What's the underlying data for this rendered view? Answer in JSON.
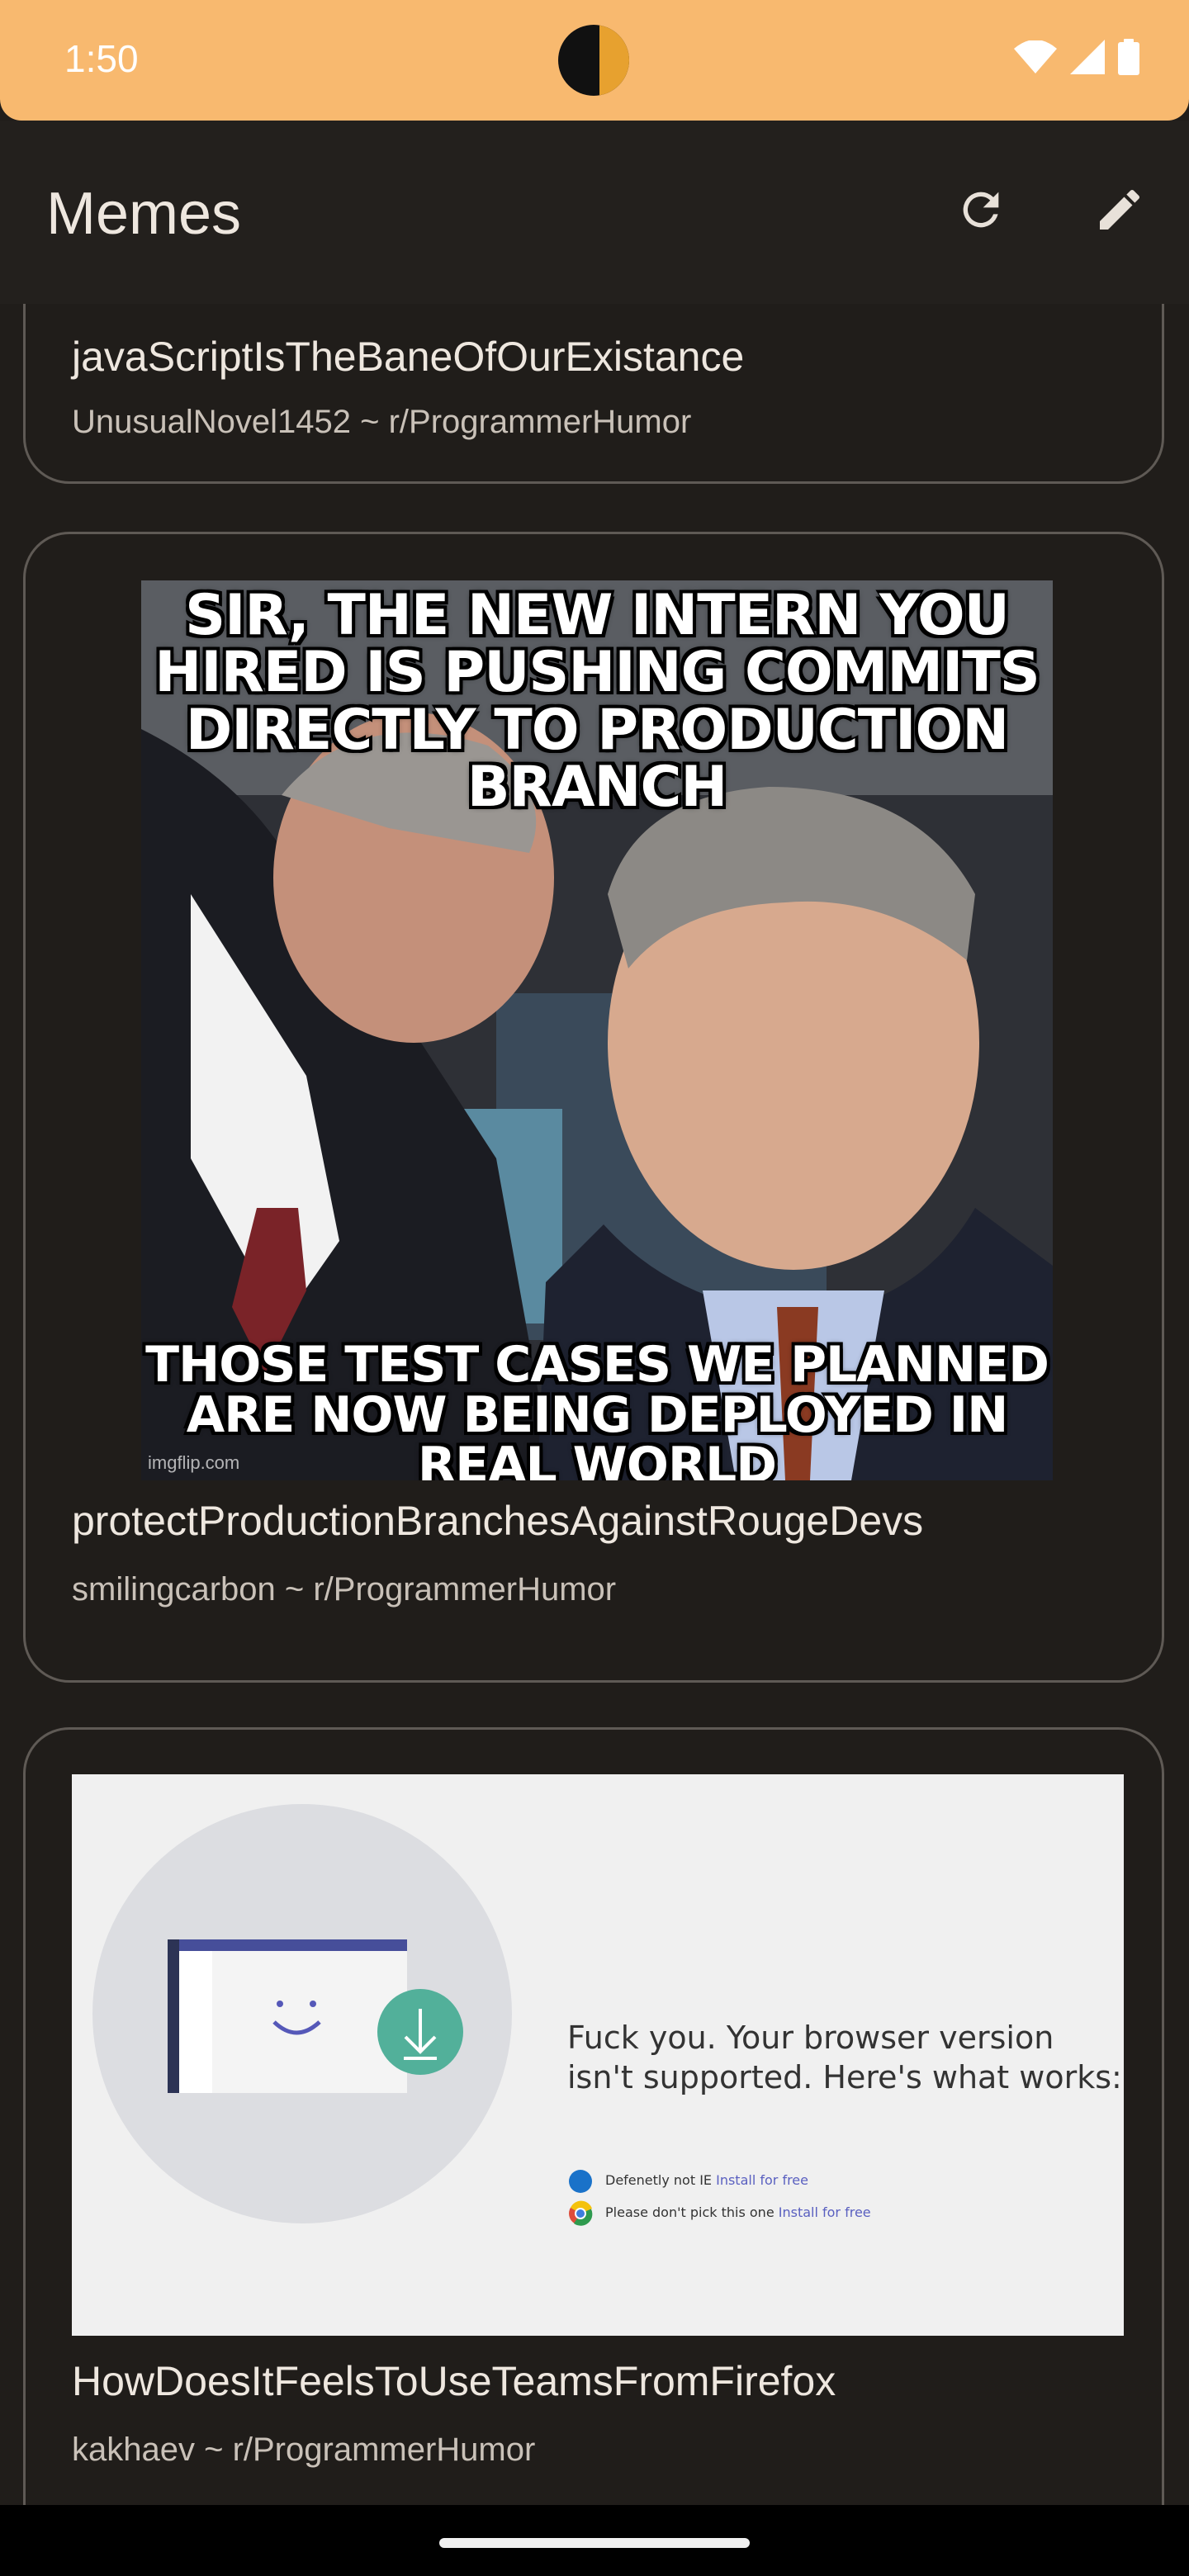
{
  "status_bar": {
    "time": "1:50",
    "icons": [
      "wifi-icon",
      "cell-signal-icon",
      "battery-icon"
    ]
  },
  "app_bar": {
    "title": "Memes",
    "actions": [
      "refresh-icon",
      "edit-icon"
    ]
  },
  "posts": [
    {
      "title": "javaScriptIsTheBaneOfOurExistance",
      "subtitle": "UnusualNovel1452 ~ r/ProgrammerHumor"
    },
    {
      "title": "protectProductionBranchesAgainstRougeDevs",
      "subtitle": "smilingcarbon ~ r/ProgrammerHumor",
      "image_text": {
        "top_line1": "SIR, THE NEW INTERN YOU",
        "top_line2": "HIRED IS PUSHING COMMITS",
        "top_line3": "DIRECTLY TO PRODUCTION BRANCH",
        "bottom_line1": "THOSE TEST CASES WE PLANNED",
        "bottom_line2": "ARE NOW BEING DEPLOYED IN REAL WORLD",
        "watermark": "imgflip.com"
      }
    },
    {
      "title": "HowDoesItFeelsToUseTeamsFromFirefox",
      "subtitle": "kakhaev ~ r/ProgrammerHumor",
      "image_text": {
        "headline_line1": "Fuck you. Your browser version",
        "headline_line2": "isn't supported. Here's what works:",
        "option1_label": "Defenetly not IE",
        "option1_link": "Install for free",
        "option2_label": "Please don't pick this one",
        "option2_link": "Install for free"
      }
    }
  ],
  "colors": {
    "status_bar": "#f8b96f",
    "background": "#201d1a",
    "card_border": "#5f5a55",
    "title_text": "#eee7df",
    "subtitle_text": "#c9c1b8"
  }
}
